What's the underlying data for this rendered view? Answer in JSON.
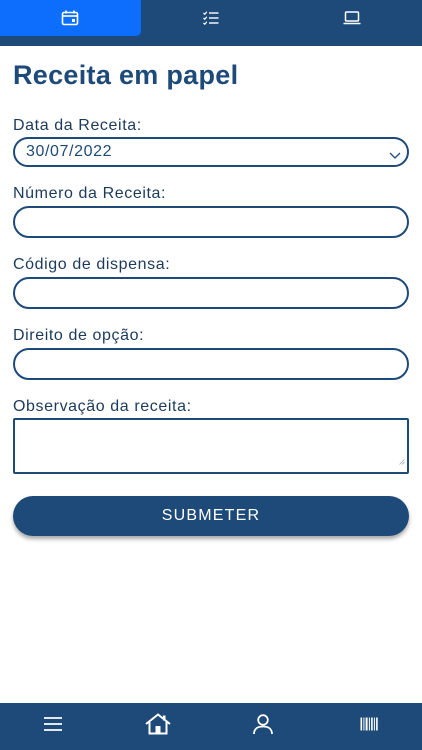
{
  "top_tabs": [
    {
      "icon": "calendar-icon",
      "active": true
    },
    {
      "icon": "checklist-icon",
      "active": false
    },
    {
      "icon": "laptop-icon",
      "active": false
    }
  ],
  "page_title": "Receita em papel",
  "form": {
    "date_label": "Data da Receita:",
    "date_value": "30/07/2022",
    "number_label": "Número da Receita:",
    "number_value": "",
    "dispense_code_label": "Código de dispensa:",
    "dispense_code_value": "",
    "option_right_label": "Direito de opção:",
    "option_right_value": "",
    "observation_label": "Observação da receita:",
    "observation_value": "",
    "submit_label": "SUBMETER"
  },
  "bottom_nav": [
    {
      "icon": "menu-icon"
    },
    {
      "icon": "home-icon"
    },
    {
      "icon": "user-icon"
    },
    {
      "icon": "barcode-icon"
    }
  ],
  "colors": {
    "primary": "#1d4a78",
    "active_tab": "#0d6efd",
    "background": "#ffffff"
  }
}
